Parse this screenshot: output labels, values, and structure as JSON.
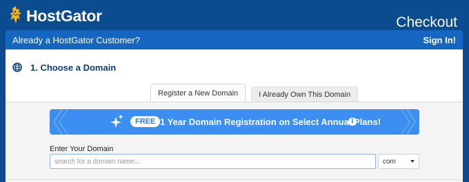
{
  "header": {
    "brand": "HostGator",
    "page_title": "Checkout"
  },
  "customer_bar": {
    "question": "Already a HostGator Customer?",
    "signin_label": "Sign In!"
  },
  "section": {
    "title": "1. Choose a Domain",
    "icon": "globe-icon"
  },
  "tabs": [
    {
      "label": "Register a New Domain",
      "active": true
    },
    {
      "label": "I Already Own This Domain",
      "active": false
    }
  ],
  "promo": {
    "badge": "FREE",
    "text": "1 Year Domain Registration on Select Annual Plans!",
    "icons": [
      "sparkle-icon",
      "info-icon"
    ]
  },
  "domain_form": {
    "label": "Enter Your Domain",
    "placeholder": "search for a domain name...",
    "value": "",
    "tld_selected": "com"
  },
  "colors": {
    "page_bg": "#0b4b8f",
    "customer_bar": "#1466c0",
    "promo_bg": "#3c8ef0",
    "section_title": "#0b3e7e"
  }
}
